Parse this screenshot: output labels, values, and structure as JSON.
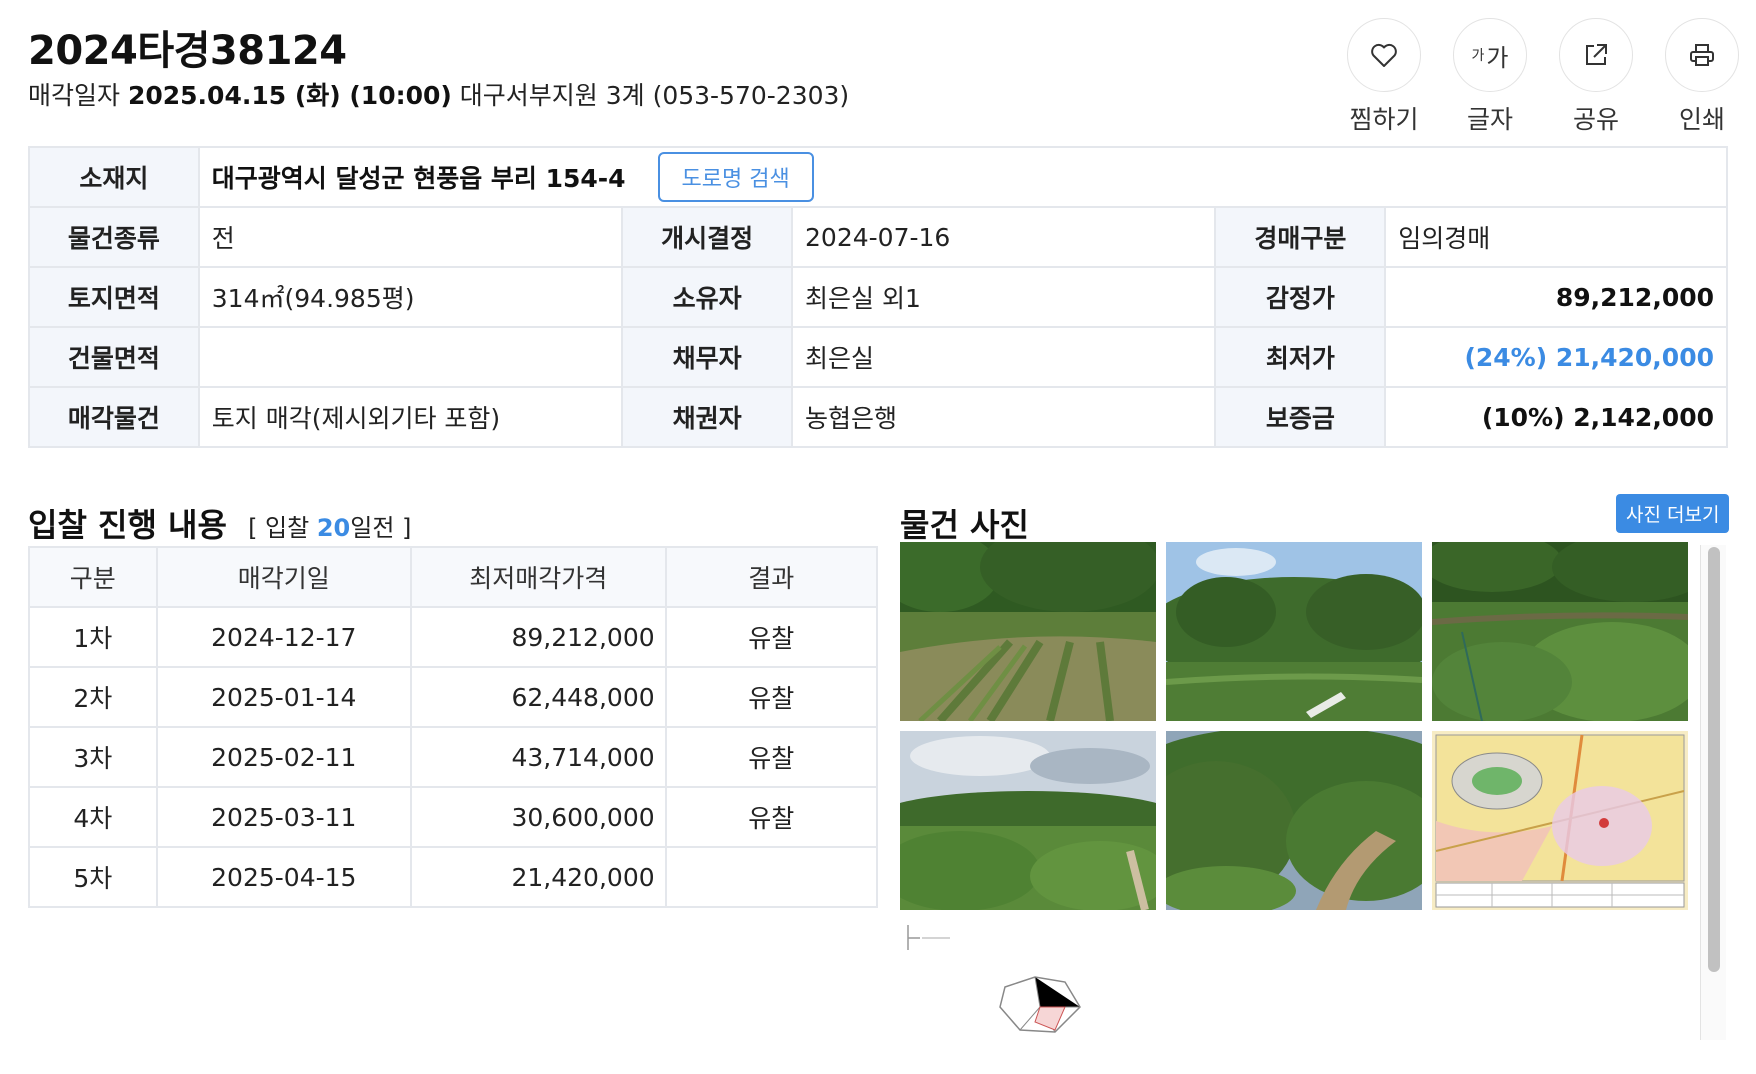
{
  "header": {
    "case_no": "2024타경38124",
    "sale_label": "매각일자",
    "sale_datetime": "2025.04.15 (화) (10:00)",
    "court": "대구서부지원 3계 (053-570-2303)"
  },
  "actions": [
    {
      "label": "찜하기",
      "icon": "heart-icon"
    },
    {
      "label": "글자",
      "icon": "font-size-icon",
      "glyph_small": "가",
      "glyph_big": "가"
    },
    {
      "label": "공유",
      "icon": "share-icon"
    },
    {
      "label": "인쇄",
      "icon": "print-icon"
    }
  ],
  "info": {
    "location": {
      "label": "소재지",
      "value": "대구광역시 달성군 현풍읍 부리 154-4",
      "button": "도로명 검색"
    },
    "rows": [
      [
        {
          "label": "물건종류",
          "value": "전"
        },
        {
          "label": "개시결정",
          "value": "2024-07-16"
        },
        {
          "label": "경매구분",
          "value": "임의경매"
        }
      ],
      [
        {
          "label": "토지면적",
          "value": "314㎡(94.985평)"
        },
        {
          "label": "소유자",
          "value": "최은실 외1"
        },
        {
          "label": "감정가",
          "value": "89,212,000"
        }
      ],
      [
        {
          "label": "건물면적",
          "value": ""
        },
        {
          "label": "채무자",
          "value": "최은실"
        },
        {
          "label": "최저가",
          "value": "(24%) 21,420,000"
        }
      ],
      [
        {
          "label": "매각물건",
          "value": "토지 매각(제시외기타 포함)"
        },
        {
          "label": "채권자",
          "value": "농협은행"
        },
        {
          "label": "보증금",
          "value": "(10%) 2,142,000"
        }
      ]
    ]
  },
  "bid": {
    "title": "입찰 진행 내용",
    "note_prefix": "[ 입찰 ",
    "note_days": "20",
    "note_suffix": "일전 ]",
    "headers": [
      "구분",
      "매각기일",
      "최저매각가격",
      "결과"
    ],
    "rows": [
      [
        "1차",
        "2024-12-17",
        "89,212,000",
        "유찰"
      ],
      [
        "2차",
        "2025-01-14",
        "62,448,000",
        "유찰"
      ],
      [
        "3차",
        "2025-02-11",
        "43,714,000",
        "유찰"
      ],
      [
        "4차",
        "2025-03-11",
        "30,600,000",
        "유찰"
      ],
      [
        "5차",
        "2025-04-15",
        "21,420,000",
        ""
      ]
    ]
  },
  "photos": {
    "title": "물건 사진",
    "more_button": "사진 더보기"
  }
}
